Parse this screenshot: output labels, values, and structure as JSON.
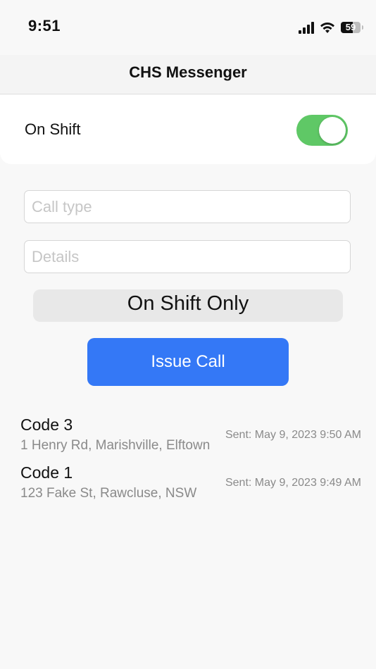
{
  "status_bar": {
    "time": "9:51",
    "battery_level": "59",
    "icons": [
      "cellular-signal-icon",
      "wifi-icon",
      "battery-icon"
    ]
  },
  "nav": {
    "title": "CHS Messenger"
  },
  "shift": {
    "label": "On Shift",
    "toggle_on": true,
    "toggle_color": "#5fc866"
  },
  "form": {
    "call_type": {
      "value": "",
      "placeholder": "Call type"
    },
    "details": {
      "value": "",
      "placeholder": "Details"
    },
    "filter_label": "On Shift Only",
    "issue_button_label": "Issue Call",
    "accent_color": "#3478f6"
  },
  "calls": [
    {
      "code": "Code 3",
      "address": "1 Henry Rd, Marishville, Elftown",
      "sent": "Sent: May 9, 2023 9:50 AM"
    },
    {
      "code": "Code 1",
      "address": "123 Fake St, Rawcluse, NSW",
      "sent": "Sent: May 9, 2023 9:49 AM"
    }
  ]
}
